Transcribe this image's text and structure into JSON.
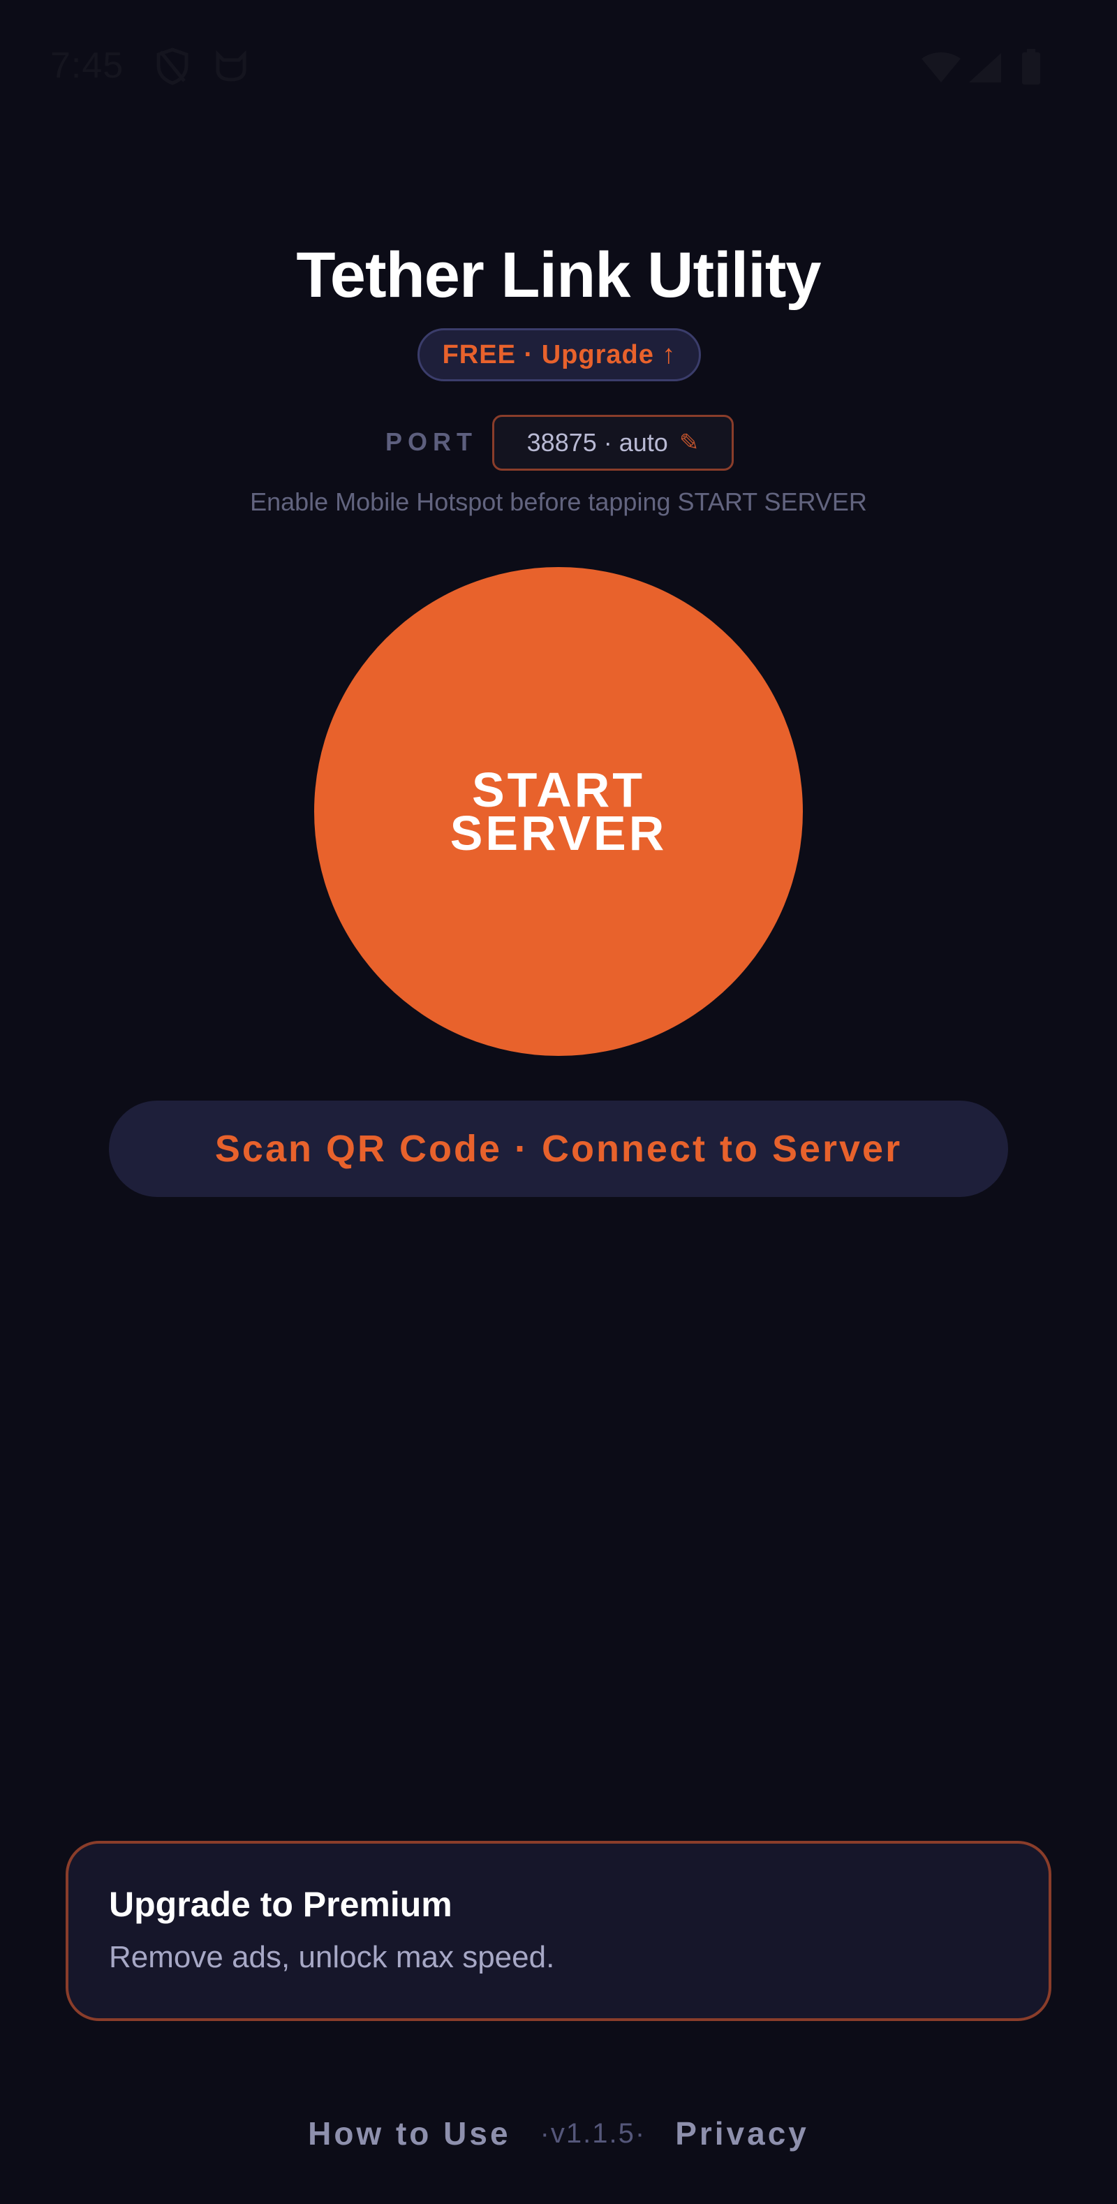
{
  "status_bar": {
    "time": "7:45"
  },
  "header": {
    "title": "Tether Link Utility",
    "plan_badge": "FREE · Upgrade ↑"
  },
  "port": {
    "label": "PORT",
    "value": "38875 · auto",
    "edit_icon": "✎"
  },
  "hint": "Enable Mobile Hotspot before tapping START SERVER",
  "start_button": {
    "line1": "START",
    "line2": "SERVER"
  },
  "scan_button": {
    "label": "Scan QR Code · Connect to Server"
  },
  "premium_card": {
    "title": "Upgrade to Premium",
    "subtitle": "Remove ads, unlock max speed."
  },
  "footer": {
    "how_to_use": "How to Use",
    "version": "·v1.1.5·",
    "privacy": "Privacy"
  },
  "colors": {
    "background": "#0c0c17",
    "accent": "#e8622c",
    "surface": "#1e1f3a",
    "muted_text": "#62647f"
  },
  "icons": {
    "status": [
      "shield-slash-icon",
      "cat-icon",
      "wifi-icon",
      "signal-icon",
      "battery-icon"
    ],
    "port_edit": "pencil-icon"
  }
}
